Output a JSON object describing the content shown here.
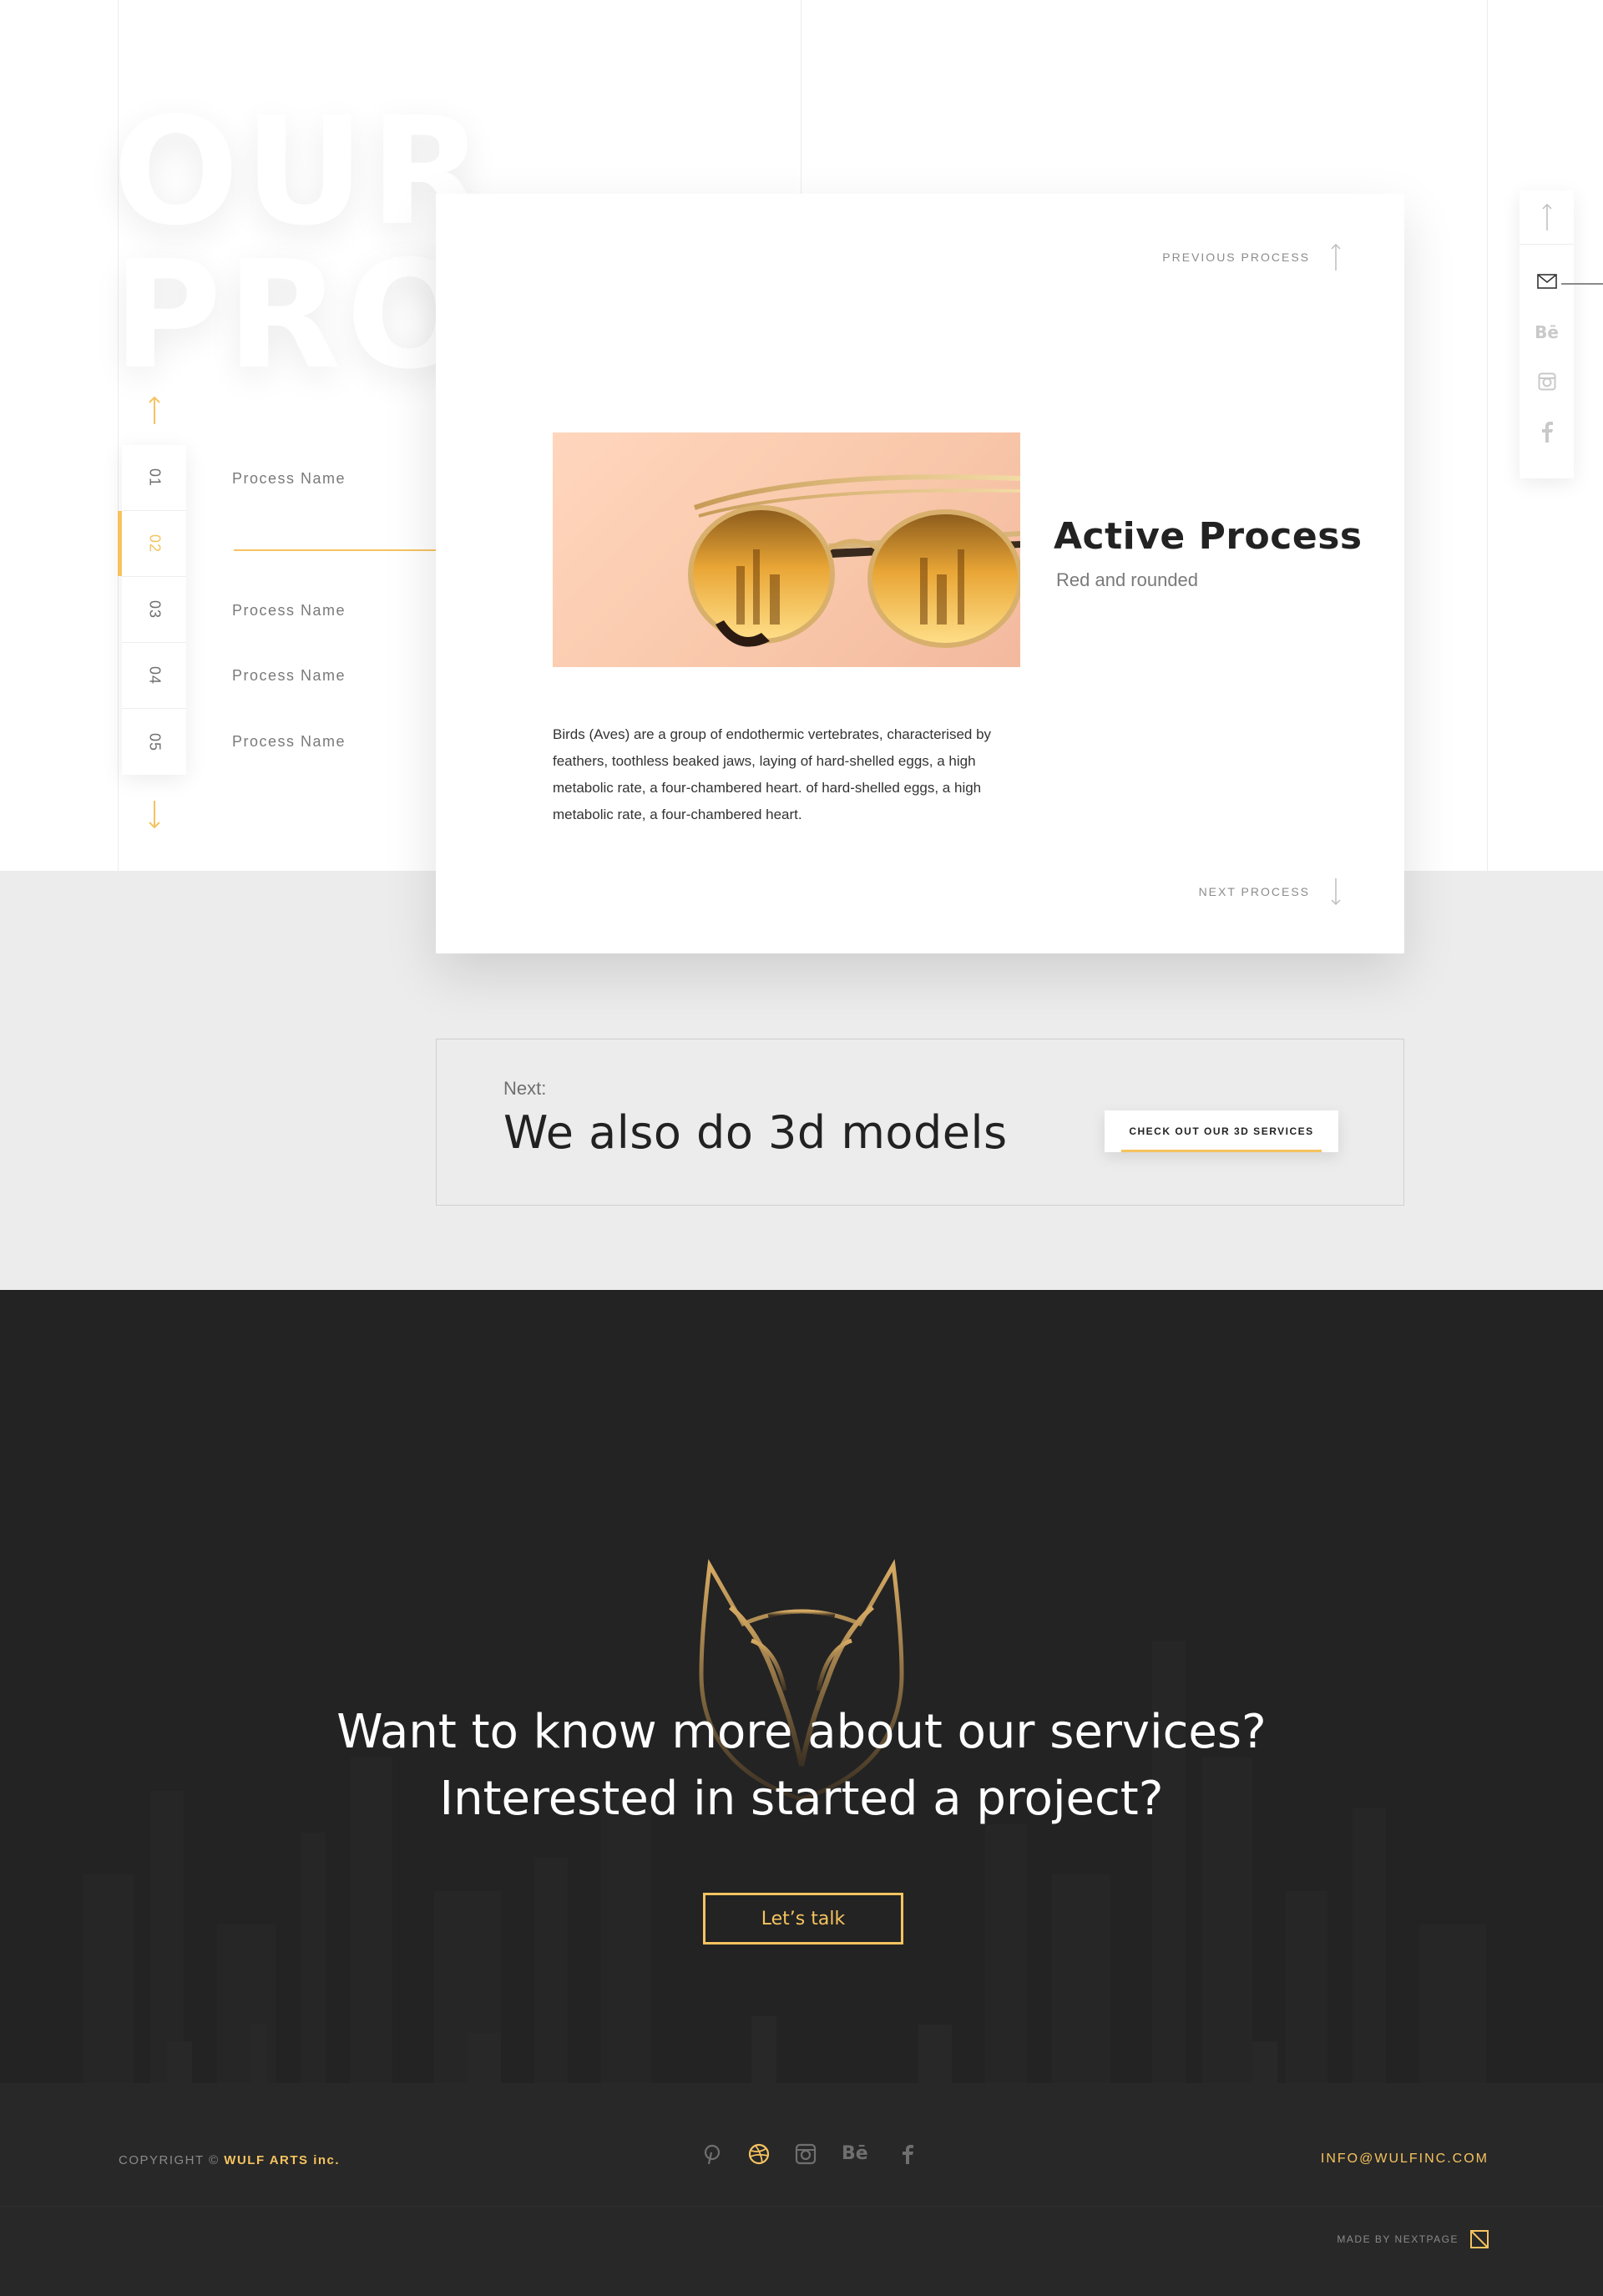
{
  "page": {
    "title_line1": "OUR",
    "title_line2": "PROCESS"
  },
  "steps": [
    {
      "num": "01",
      "label": "Process Name"
    },
    {
      "num": "02",
      "label": ""
    },
    {
      "num": "03",
      "label": "Process Name"
    },
    {
      "num": "04",
      "label": "Process Name"
    },
    {
      "num": "05",
      "label": "Process Name"
    }
  ],
  "active_step": "02",
  "card": {
    "previous_label": "PREVIOUS PROCESS",
    "next_label": "NEXT PROCESS",
    "title": "Active Process",
    "subtitle": "Red and rounded",
    "description": "Birds (Aves) are a group of endothermic vertebrates, characterised by feathers, toothless beaked jaws, laying of hard-shelled eggs, a high metabolic rate, a four-chambered heart. of hard-shelled eggs, a high metabolic rate, a four-chambered heart."
  },
  "next_section": {
    "label": "Next:",
    "title": "We also do 3d models",
    "cta": "CHECK OUT OUR 3D SERVICES"
  },
  "social_sidebar": [
    "up-arrow-icon",
    "mail-icon",
    "behance-icon",
    "instagram-icon",
    "facebook-icon"
  ],
  "cta_section": {
    "line1": "Want to know more about our services?",
    "line2": "Interested in started a project?",
    "button": "Let’s talk"
  },
  "footer": {
    "copyright_prefix": "COPYRIGHT ©",
    "company": "WULF ARTS inc.",
    "icons": [
      "pinterest-icon",
      "dribbble-icon",
      "instagram-icon",
      "behance-icon",
      "facebook-icon"
    ],
    "email": "INFO@WULFINC.COM",
    "made_by": "MADE BY NEXTPAGE"
  },
  "colors": {
    "accent": "#f6c35f",
    "dark_bg": "#232323",
    "grey_bg": "#ececec"
  }
}
